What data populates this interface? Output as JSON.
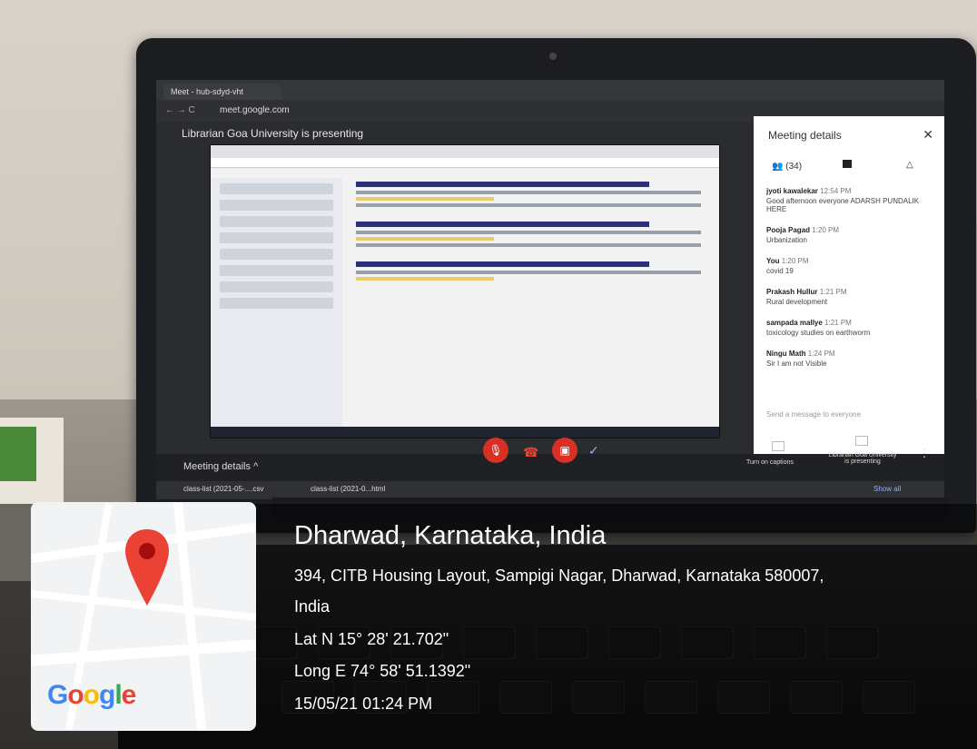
{
  "browser": {
    "tab_label": "Meet - hub-sdyd-vht",
    "url": "meet.google.com"
  },
  "meet": {
    "presenting_banner": "Librarian Goa University is presenting",
    "panel_title": "Meeting details",
    "people_count": "(34)",
    "messages": [
      {
        "sender": "jyoti kawalekar",
        "time": "12:54 PM",
        "text": "Good afternoon everyone ADARSH PUNDALIK HERE"
      },
      {
        "sender": "Pooja Pagad",
        "time": "1:20 PM",
        "text": "Urbanization"
      },
      {
        "sender": "You",
        "time": "1:20 PM",
        "text": "covid 19"
      },
      {
        "sender": "Prakash Hullur",
        "time": "1:21 PM",
        "text": "Rural development"
      },
      {
        "sender": "sampada mallye",
        "time": "1:21 PM",
        "text": "toxicology studies on earthworm"
      },
      {
        "sender": "Ningu Math",
        "time": "1:24 PM",
        "text": "Sir I am not Visible"
      }
    ],
    "send_placeholder": "Send a message to everyone",
    "meeting_details_button": "Meeting details",
    "captions_label": "Turn on captions",
    "presenter_label": "Librarian Goa University is presenting",
    "downloads": [
      "class-list (2021-05-....csv",
      "class-list (2021-0...html"
    ],
    "show_all": "Show all"
  },
  "location_stamp": {
    "city": "Dharwad, Karnataka, India",
    "address_line1": "394, CITB Housing Layout, Sampigi Nagar, Dharwad, Karnataka 580007,",
    "address_line2": "India",
    "lat": "Lat N 15° 28' 21.702\"",
    "long": "Long E 74° 58' 51.1392\"",
    "datetime": "15/05/21 01:24 PM",
    "map_brand": "Google"
  },
  "colors": {
    "pin": "#ea4335",
    "mic_off": "#d93025"
  }
}
